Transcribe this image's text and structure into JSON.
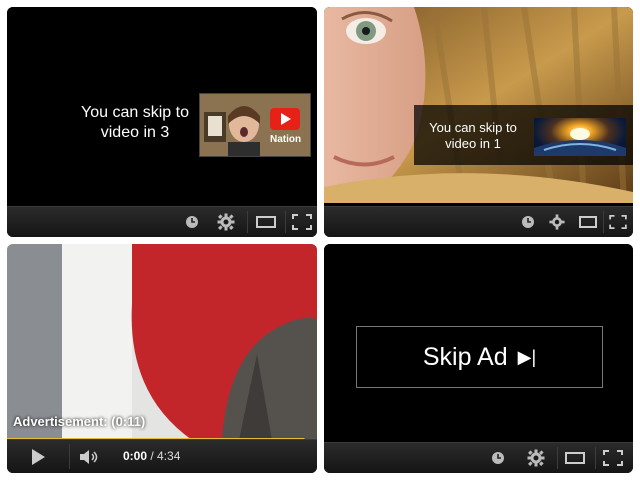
{
  "panels": [
    {
      "skip_text": "You can skip to video in 3",
      "thumbnail_text": "Nation",
      "thumbnail_icon": "youtube-play-icon"
    },
    {
      "skip_text": "You can skip to video in 1",
      "thumbnail_icon": "sunrise-earth-image"
    },
    {
      "ad_label": "Advertisement: (0:11)",
      "time_current": "0:00",
      "time_separator": " / ",
      "time_total": "4:34",
      "progress_fraction": 0.96
    },
    {
      "skip_ad_label": "Skip Ad",
      "skip_ad_icon": "▶|"
    }
  ],
  "controls_icons": [
    "watch-later-icon",
    "settings-gear-icon",
    "theater-mode-icon",
    "fullscreen-icon"
  ],
  "colors": {
    "progress": "#e5b93a",
    "controls_bg": "#1f1f1f",
    "youtube_red": "#e62117"
  }
}
